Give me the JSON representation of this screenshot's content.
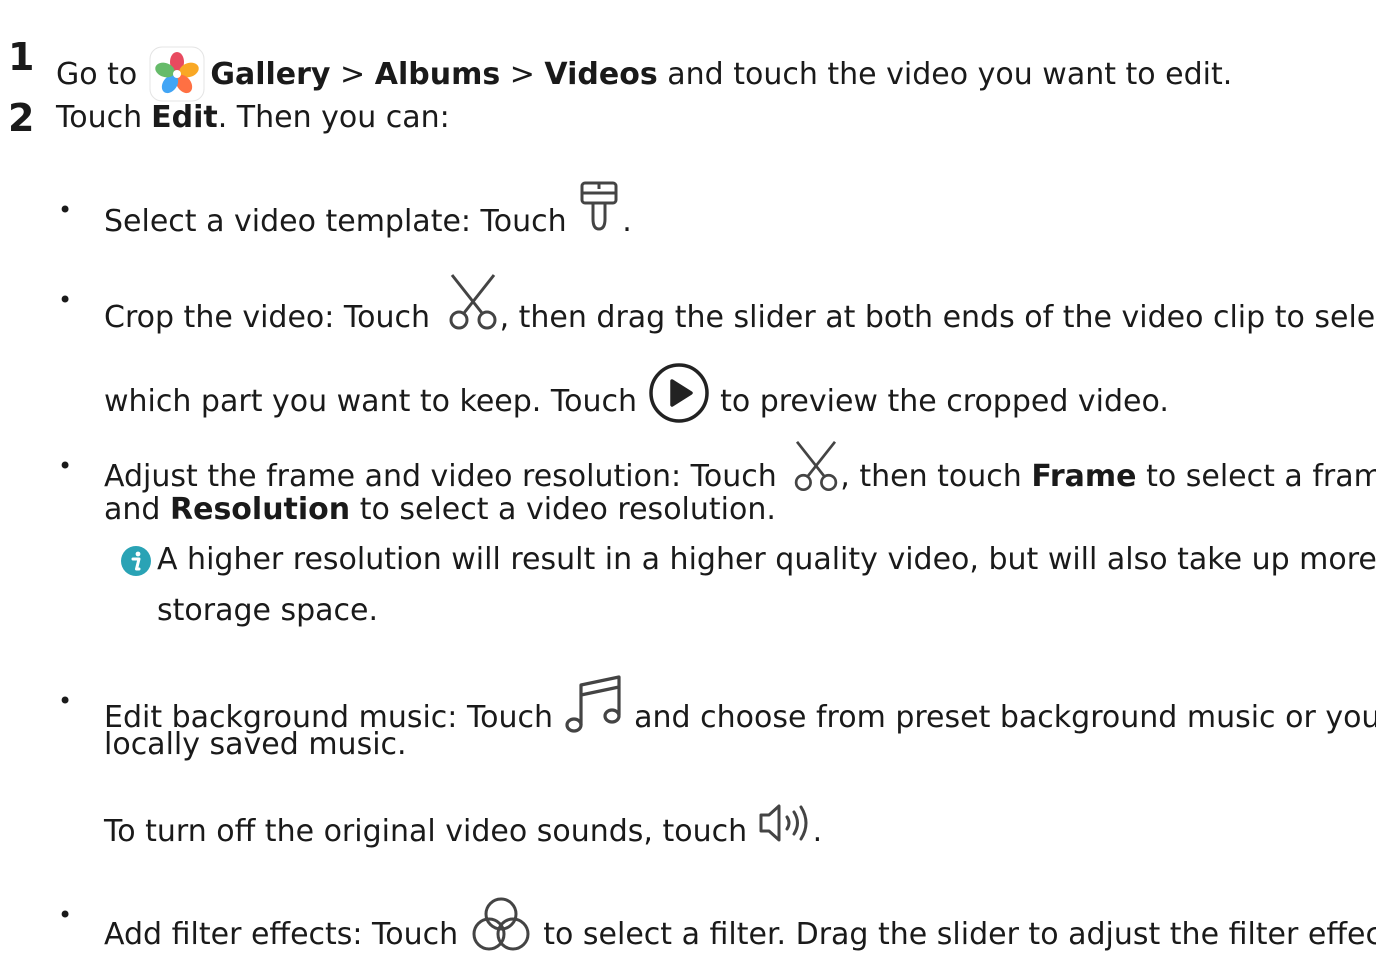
{
  "steps": [
    {
      "number": "1",
      "parts": {
        "go_to": "Go to",
        "gallery": "Gallery",
        "sep1": ">",
        "albums": "Albums",
        "sep2": ">",
        "videos": "Videos",
        "rest": "and touch the video you want to edit."
      }
    },
    {
      "number": "2",
      "parts": {
        "touch": "Touch",
        "edit": "Edit",
        "rest": ". Then you can:"
      }
    }
  ],
  "bullets": {
    "template": {
      "text": "Select a video template: Touch",
      "end": "."
    },
    "crop": {
      "text1": "Crop the video: Touch",
      "text2": ", then drag the slider at both ends of the video clip to select",
      "text3": "which part you want to keep. Touch",
      "text4": "to preview the cropped video."
    },
    "frame": {
      "text1": "Adjust the frame and video resolution: Touch",
      "text2": ", then touch",
      "frame": "Frame",
      "text3": "to select a frame,",
      "and": "and",
      "resolution": "Resolution",
      "text4": "to select a video resolution."
    },
    "note": {
      "line1": "A higher resolution will result in a higher quality video, but will also take up more",
      "line2": "storage space."
    },
    "music": {
      "text1": "Edit background music: Touch",
      "text2": "and choose from preset background music or your",
      "text3": "locally saved music.",
      "sound1": "To turn off the original video sounds, touch",
      "sound_end": "."
    },
    "filter": {
      "text1": "Add filter effects: Touch",
      "text2": "to select a filter. Drag the slider to adjust the filter effect."
    }
  },
  "bullet_char": "•",
  "colors": {
    "text": "#1a1a1a",
    "info_icon": "#2aa3b5",
    "icon_stroke": "#444444"
  },
  "icons": [
    "gallery-app-icon",
    "paintbrush-icon",
    "scissors-icon",
    "play-icon",
    "scissors-icon",
    "info-icon",
    "music-note-icon",
    "speaker-icon",
    "filter-circles-icon"
  ]
}
